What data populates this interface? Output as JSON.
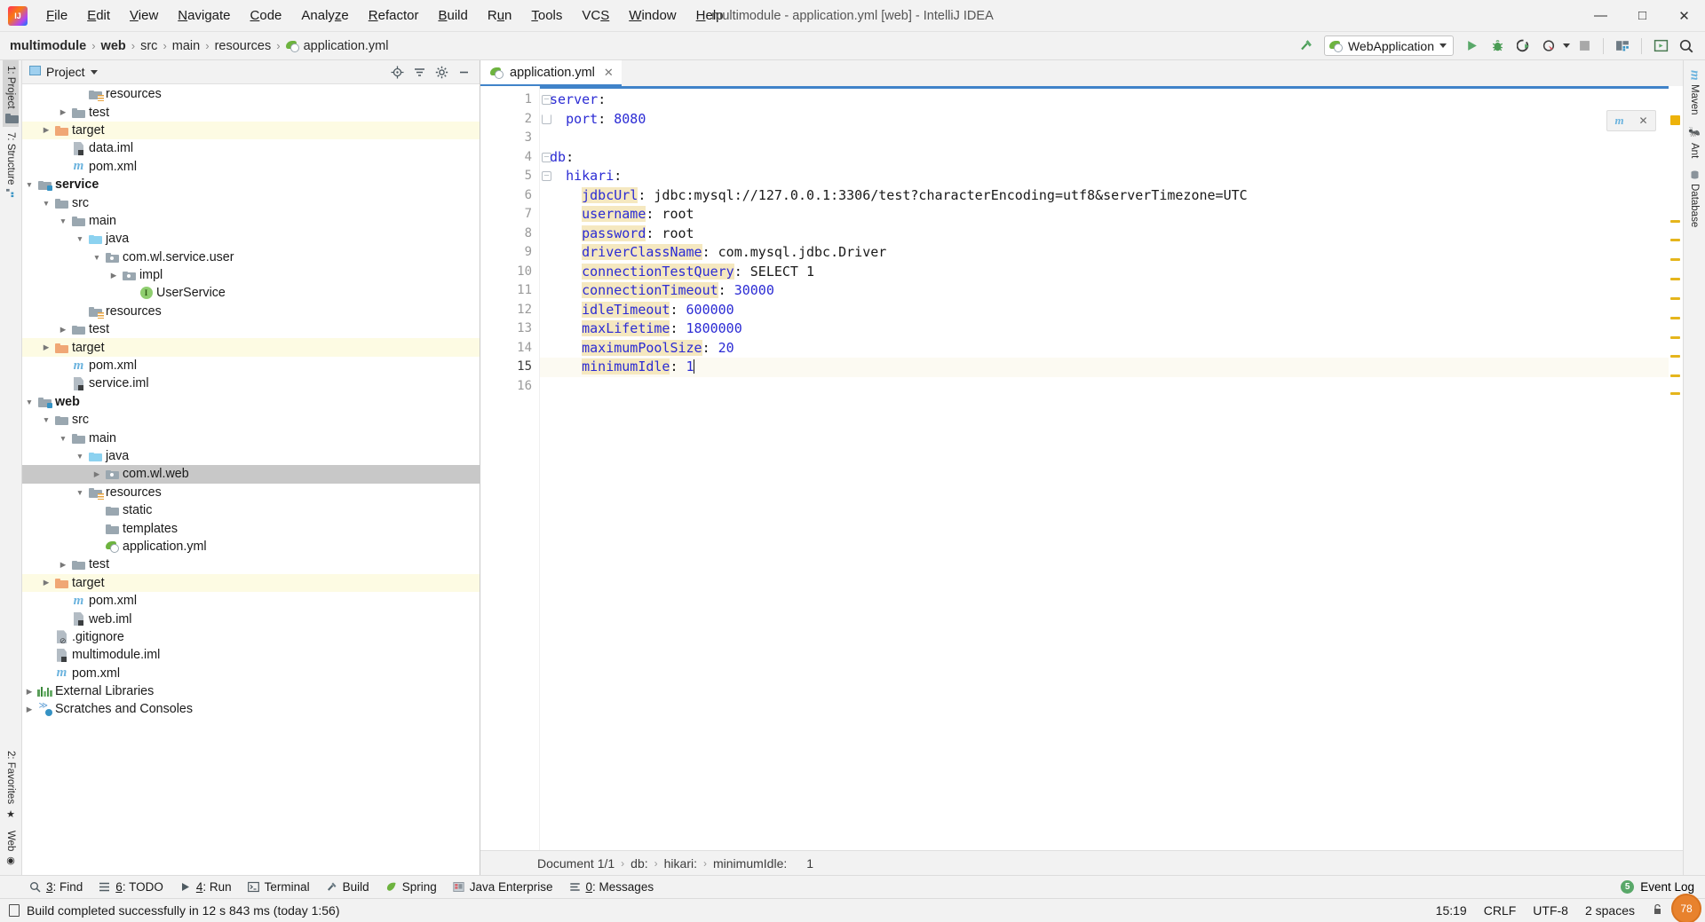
{
  "titlebar": {
    "logo_icon": "intellij-logo-icon",
    "window_title": "multimodule - application.yml [web] - IntelliJ IDEA",
    "menus": [
      "File",
      "Edit",
      "View",
      "Navigate",
      "Code",
      "Analyze",
      "Refactor",
      "Build",
      "Run",
      "Tools",
      "VCS",
      "Window",
      "Help"
    ],
    "minimize": "—",
    "maximize": "□",
    "close": "✕"
  },
  "navbar": {
    "breadcrumbs": [
      "multimodule",
      "web",
      "src",
      "main",
      "resources",
      "application.yml"
    ],
    "separator": "›",
    "run_config": "WebApplication",
    "icons": [
      "hammer-build-icon",
      "run-icon",
      "debug-icon",
      "run-coverage-icon",
      "profiler-icon",
      "stop-icon",
      "project-structure-icon",
      "update-app-icon",
      "search-everywhere-icon"
    ]
  },
  "left_rail": {
    "top": [
      {
        "label": "1: Project",
        "icon": "project-panel-icon",
        "active": true
      },
      {
        "label": "7: Structure",
        "icon": "structure-icon",
        "active": false
      }
    ],
    "bottom": [
      {
        "label": "2: Favorites",
        "icon": "star-icon"
      },
      {
        "label": "Web",
        "icon": "web-icon"
      }
    ]
  },
  "right_rail": [
    {
      "label": "Maven",
      "icon": "maven-icon"
    },
    {
      "label": "Ant",
      "icon": "ant-icon"
    },
    {
      "label": "Database",
      "icon": "database-icon"
    }
  ],
  "project_panel": {
    "title": "Project",
    "title_icon": "project-view-icon",
    "dropdown": "▾",
    "tools": [
      "locate-icon",
      "collapse-all-icon",
      "settings-gear-icon",
      "hide-icon"
    ],
    "tree": [
      {
        "indent": 3,
        "arrow": "",
        "icon": "folder-resources",
        "label": "resources",
        "style": "normal",
        "row": "normal"
      },
      {
        "indent": 2,
        "arrow": "▶",
        "icon": "folder-gray",
        "label": "test",
        "style": "normal",
        "row": "normal"
      },
      {
        "indent": 1,
        "arrow": "▶",
        "icon": "folder-orange",
        "label": "target",
        "style": "normal",
        "row": "target"
      },
      {
        "indent": 2,
        "arrow": "",
        "icon": "iml-file",
        "label": "data.iml",
        "style": "normal",
        "row": "normal"
      },
      {
        "indent": 2,
        "arrow": "",
        "icon": "maven-file",
        "label": "pom.xml",
        "style": "normal",
        "row": "normal"
      },
      {
        "indent": 0,
        "arrow": "▼",
        "icon": "folder-module",
        "label": "service",
        "style": "bold",
        "row": "normal"
      },
      {
        "indent": 1,
        "arrow": "▼",
        "icon": "folder-gray",
        "label": "src",
        "style": "normal",
        "row": "normal"
      },
      {
        "indent": 2,
        "arrow": "▼",
        "icon": "folder-gray",
        "label": "main",
        "style": "normal",
        "row": "normal"
      },
      {
        "indent": 3,
        "arrow": "▼",
        "icon": "folder-blue",
        "label": "java",
        "style": "normal",
        "row": "normal"
      },
      {
        "indent": 4,
        "arrow": "▼",
        "icon": "folder-package",
        "label": "com.wl.service.user",
        "style": "normal",
        "row": "normal"
      },
      {
        "indent": 5,
        "arrow": "▶",
        "icon": "folder-package",
        "label": "impl",
        "style": "normal",
        "row": "normal"
      },
      {
        "indent": 6,
        "arrow": "",
        "icon": "interface-icon",
        "label": "UserService",
        "style": "normal",
        "row": "normal"
      },
      {
        "indent": 3,
        "arrow": "",
        "icon": "folder-resources",
        "label": "resources",
        "style": "normal",
        "row": "normal"
      },
      {
        "indent": 2,
        "arrow": "▶",
        "icon": "folder-gray",
        "label": "test",
        "style": "normal",
        "row": "normal"
      },
      {
        "indent": 1,
        "arrow": "▶",
        "icon": "folder-orange",
        "label": "target",
        "style": "normal",
        "row": "target"
      },
      {
        "indent": 2,
        "arrow": "",
        "icon": "maven-file",
        "label": "pom.xml",
        "style": "normal",
        "row": "normal"
      },
      {
        "indent": 2,
        "arrow": "",
        "icon": "iml-file",
        "label": "service.iml",
        "style": "normal",
        "row": "normal"
      },
      {
        "indent": 0,
        "arrow": "▼",
        "icon": "folder-module",
        "label": "web",
        "style": "bold",
        "row": "normal"
      },
      {
        "indent": 1,
        "arrow": "▼",
        "icon": "folder-gray",
        "label": "src",
        "style": "normal",
        "row": "normal"
      },
      {
        "indent": 2,
        "arrow": "▼",
        "icon": "folder-gray",
        "label": "main",
        "style": "normal",
        "row": "normal"
      },
      {
        "indent": 3,
        "arrow": "▼",
        "icon": "folder-blue",
        "label": "java",
        "style": "normal",
        "row": "normal"
      },
      {
        "indent": 4,
        "arrow": "▶",
        "icon": "folder-package",
        "label": "com.wl.web",
        "style": "normal",
        "row": "selected"
      },
      {
        "indent": 3,
        "arrow": "▼",
        "icon": "folder-resources",
        "label": "resources",
        "style": "normal",
        "row": "normal"
      },
      {
        "indent": 4,
        "arrow": "",
        "icon": "folder-gray",
        "label": "static",
        "style": "normal",
        "row": "normal"
      },
      {
        "indent": 4,
        "arrow": "",
        "icon": "folder-gray",
        "label": "templates",
        "style": "normal",
        "row": "normal"
      },
      {
        "indent": 4,
        "arrow": "",
        "icon": "spring-yml-icon",
        "label": "application.yml",
        "style": "normal",
        "row": "normal"
      },
      {
        "indent": 2,
        "arrow": "▶",
        "icon": "folder-gray",
        "label": "test",
        "style": "normal",
        "row": "normal"
      },
      {
        "indent": 1,
        "arrow": "▶",
        "icon": "folder-orange",
        "label": "target",
        "style": "normal",
        "row": "target"
      },
      {
        "indent": 2,
        "arrow": "",
        "icon": "maven-file",
        "label": "pom.xml",
        "style": "normal",
        "row": "normal"
      },
      {
        "indent": 2,
        "arrow": "",
        "icon": "iml-file",
        "label": "web.iml",
        "style": "normal",
        "row": "normal"
      },
      {
        "indent": 1,
        "arrow": "",
        "icon": "gitignore-icon",
        "label": ".gitignore",
        "style": "normal",
        "row": "normal"
      },
      {
        "indent": 1,
        "arrow": "",
        "icon": "iml-file",
        "label": "multimodule.iml",
        "style": "normal",
        "row": "normal"
      },
      {
        "indent": 1,
        "arrow": "",
        "icon": "maven-file",
        "label": "pom.xml",
        "style": "normal",
        "row": "normal"
      },
      {
        "indent": 0,
        "arrow": "▶",
        "icon": "external-libraries-icon",
        "label": "External Libraries",
        "style": "normal",
        "row": "normal"
      },
      {
        "indent": 0,
        "arrow": "▶",
        "icon": "scratches-icon",
        "label": "Scratches and Consoles",
        "style": "normal",
        "row": "normal"
      }
    ]
  },
  "editor": {
    "tab": {
      "label": "application.yml",
      "icon": "spring-yml-icon",
      "close": "✕"
    },
    "line_numbers": [
      "1",
      "2",
      "3",
      "4",
      "5",
      "6",
      "7",
      "8",
      "9",
      "10",
      "11",
      "12",
      "13",
      "14",
      "15",
      "16"
    ],
    "current_line": 15,
    "lines": [
      {
        "n": 1,
        "indent": 0,
        "key": "server",
        "colon": ":",
        "value": ""
      },
      {
        "n": 2,
        "indent": 2,
        "key": "port",
        "colon": ":",
        "value": "8080",
        "value_type": "num"
      },
      {
        "n": 3,
        "indent": 0,
        "key": "",
        "colon": "",
        "value": ""
      },
      {
        "n": 4,
        "indent": 0,
        "key": "db",
        "colon": ":",
        "value": ""
      },
      {
        "n": 5,
        "indent": 2,
        "key": "hikari",
        "colon": ":",
        "value": ""
      },
      {
        "n": 6,
        "indent": 4,
        "key": "jdbcUrl",
        "colon": ":",
        "value": "jdbc:mysql://127.0.0.1:3306/test?characterEncoding=utf8&serverTimezone=UTC",
        "hl": true
      },
      {
        "n": 7,
        "indent": 4,
        "key": "username",
        "colon": ":",
        "value": "root",
        "hl": true
      },
      {
        "n": 8,
        "indent": 4,
        "key": "password",
        "colon": ":",
        "value": "root",
        "hl": true
      },
      {
        "n": 9,
        "indent": 4,
        "key": "driverClassName",
        "colon": ":",
        "value": "com.mysql.jdbc.Driver",
        "hl": true
      },
      {
        "n": 10,
        "indent": 4,
        "key": "connectionTestQuery",
        "colon": ":",
        "value": "SELECT 1",
        "hl": true
      },
      {
        "n": 11,
        "indent": 4,
        "key": "connectionTimeout",
        "colon": ":",
        "value": "30000",
        "value_type": "num",
        "hl": true
      },
      {
        "n": 12,
        "indent": 4,
        "key": "idleTimeout",
        "colon": ":",
        "value": "600000",
        "value_type": "num",
        "hl": true
      },
      {
        "n": 13,
        "indent": 4,
        "key": "maxLifetime",
        "colon": ":",
        "value": "1800000",
        "value_type": "num",
        "hl": true
      },
      {
        "n": 14,
        "indent": 4,
        "key": "maximumPoolSize",
        "colon": ":",
        "value": "20",
        "value_type": "num",
        "hl": true
      },
      {
        "n": 15,
        "indent": 4,
        "key": "minimumIdle",
        "colon": ":",
        "value": "1",
        "value_type": "num",
        "hl": true,
        "caret": true
      },
      {
        "n": 16,
        "indent": 0,
        "key": "",
        "colon": "",
        "value": ""
      }
    ],
    "breadcrumbs": [
      "Document 1/1",
      "db:",
      "hikari:",
      "minimumIdle:",
      "1"
    ],
    "breadcrumb_sep": "›",
    "warning_marker_count": 11
  },
  "bottom_toolwindows": [
    {
      "num": "3",
      "label": "Find",
      "icon": "search-icon"
    },
    {
      "num": "6",
      "label": "TODO",
      "icon": "todo-list-icon"
    },
    {
      "num": "4",
      "label": "Run",
      "icon": "run-triangle-icon"
    },
    {
      "num": "",
      "label": "Terminal",
      "icon": "terminal-icon"
    },
    {
      "num": "",
      "label": "Build",
      "icon": "hammer-icon"
    },
    {
      "num": "",
      "label": "Spring",
      "icon": "spring-leaf-icon"
    },
    {
      "num": "",
      "label": "Java Enterprise",
      "icon": "java-enterprise-icon"
    },
    {
      "num": "0",
      "label": "Messages",
      "icon": "messages-icon"
    }
  ],
  "event_log": {
    "count": "5",
    "label": "Event Log"
  },
  "statusbar": {
    "message_icon": "document-status-icon",
    "message": "Build completed successfully in 12 s 843 ms (today 1:56)",
    "position": "15:19",
    "line_separator": "CRLF",
    "encoding": "UTF-8",
    "indent": "2 spaces",
    "lock_icon": "read-only-lock-icon",
    "inspection_icon": "inspections-icon",
    "memory": "78"
  },
  "colors": {
    "accent_blue": "#4083c9",
    "keyword_blue": "#2b2bd4",
    "key_highlight": "#f5e8c0",
    "target_row": "#fdfbe3",
    "selected_row": "#c8c8c8",
    "warning_marker": "#e5b51c",
    "spring_green": "#6db33f",
    "memory_orange": "#e8822d"
  }
}
